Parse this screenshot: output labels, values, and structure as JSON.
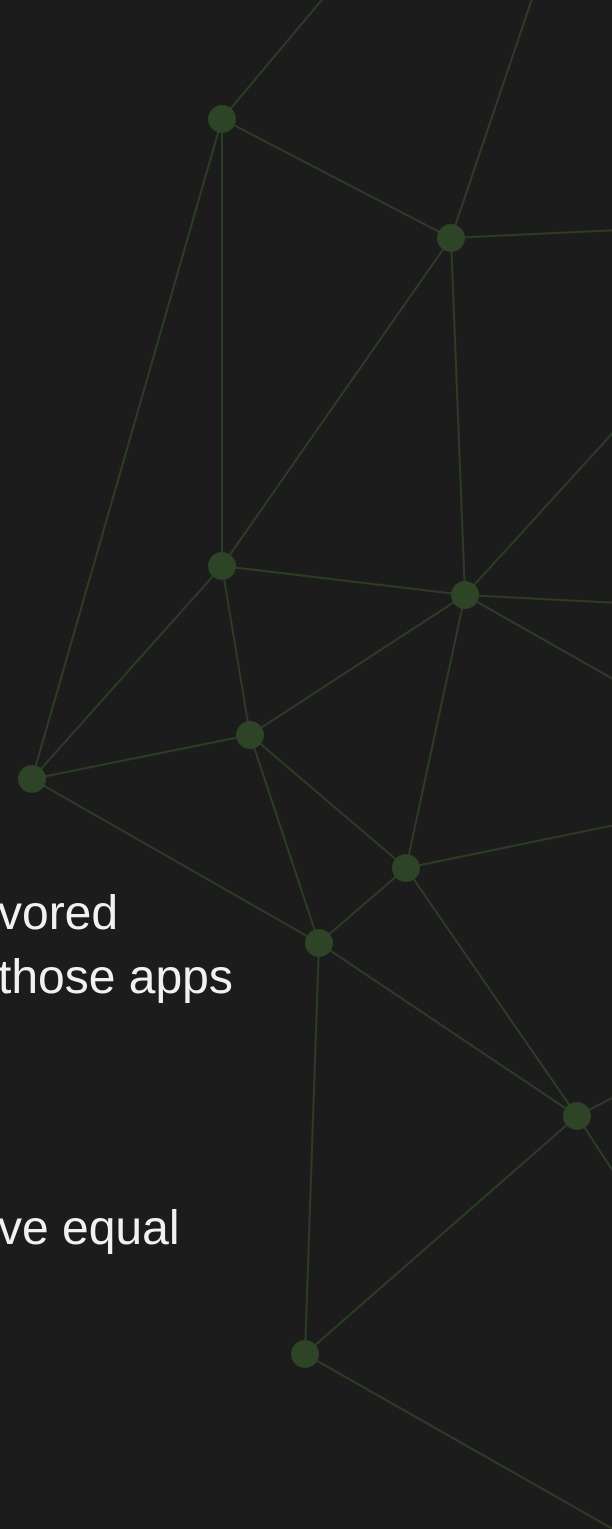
{
  "background_color": "#1c1c1c",
  "network_color": "#2e4426",
  "text_fragments": {
    "paragraph_1": [
      "vored",
      "those apps"
    ],
    "paragraph_2": [
      "ve equal"
    ]
  }
}
